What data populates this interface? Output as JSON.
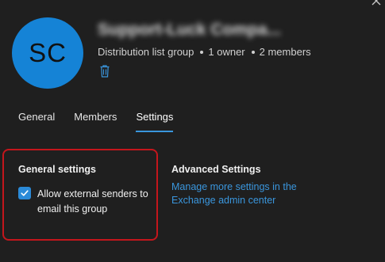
{
  "header": {
    "avatar_initials": "SC",
    "group_name": "Support-Luck Compa...",
    "group_type": "Distribution list group",
    "owners": "1 owner",
    "members": "2 members"
  },
  "icons": {
    "close": "close-icon",
    "delete": "trash-icon",
    "checkbox": "checkmark-icon"
  },
  "tabs": [
    {
      "label": "General",
      "active": false
    },
    {
      "label": "Members",
      "active": false
    },
    {
      "label": "Settings",
      "active": true
    }
  ],
  "general_settings": {
    "title": "General settings",
    "allow_external": {
      "label": "Allow external senders to email this group",
      "checked": true
    }
  },
  "advanced_settings": {
    "title": "Advanced Settings",
    "link_text": "Manage more settings in the Exchange admin center"
  },
  "colors": {
    "background": "#1f1f1f",
    "avatar": "#1583d6",
    "accent": "#3a96dd",
    "highlight_border": "#c4161c",
    "checkbox": "#2b8ad8"
  }
}
